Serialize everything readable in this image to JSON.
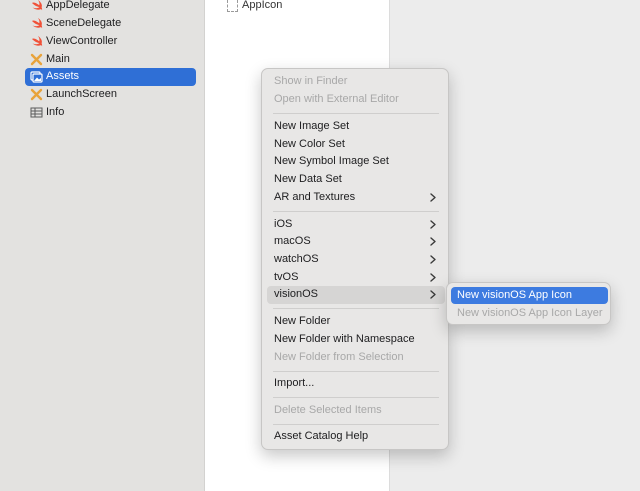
{
  "navigator": {
    "items": [
      {
        "label": "AppDelegate",
        "icon": "swift-file-icon",
        "selected": false
      },
      {
        "label": "SceneDelegate",
        "icon": "swift-file-icon",
        "selected": false
      },
      {
        "label": "ViewController",
        "icon": "swift-file-icon",
        "selected": false
      },
      {
        "label": "Main",
        "icon": "storyboard-icon",
        "selected": false
      },
      {
        "label": "Assets",
        "icon": "asset-catalog-icon",
        "selected": true
      },
      {
        "label": "LaunchScreen",
        "icon": "storyboard-icon",
        "selected": false
      },
      {
        "label": "Info",
        "icon": "plist-table-icon",
        "selected": false
      }
    ],
    "selected_color": "#2f6fd6",
    "swift_color": "#f05138",
    "storyboard_color": "#e8a33b"
  },
  "asset_list": {
    "items": [
      {
        "label": "AppIcon"
      }
    ]
  },
  "context_menu": {
    "items": [
      {
        "label": "Show in Finder",
        "enabled": false
      },
      {
        "label": "Open with External Editor",
        "enabled": false
      },
      {
        "label": "New Image Set",
        "enabled": true
      },
      {
        "label": "New Color Set",
        "enabled": true
      },
      {
        "label": "New Symbol Image Set",
        "enabled": true
      },
      {
        "label": "New Data Set",
        "enabled": true
      },
      {
        "label": "AR and Textures",
        "enabled": true,
        "submenu": true
      },
      {
        "label": "iOS",
        "enabled": true,
        "submenu": true
      },
      {
        "label": "macOS",
        "enabled": true,
        "submenu": true
      },
      {
        "label": "watchOS",
        "enabled": true,
        "submenu": true
      },
      {
        "label": "tvOS",
        "enabled": true,
        "submenu": true
      },
      {
        "label": "visionOS",
        "enabled": true,
        "submenu": true,
        "highlighted": true
      },
      {
        "label": "New Folder",
        "enabled": true
      },
      {
        "label": "New Folder with Namespace",
        "enabled": true
      },
      {
        "label": "New Folder from Selection",
        "enabled": false
      },
      {
        "label": "Import...",
        "enabled": true
      },
      {
        "label": "Delete Selected Items",
        "enabled": false
      },
      {
        "label": "Asset Catalog Help",
        "enabled": true
      }
    ]
  },
  "submenu": {
    "items": [
      {
        "label": "New visionOS App Icon",
        "enabled": true,
        "active": true
      },
      {
        "label": "New visionOS App Icon Layer",
        "enabled": false
      }
    ],
    "active_color": "#3d7be0"
  }
}
